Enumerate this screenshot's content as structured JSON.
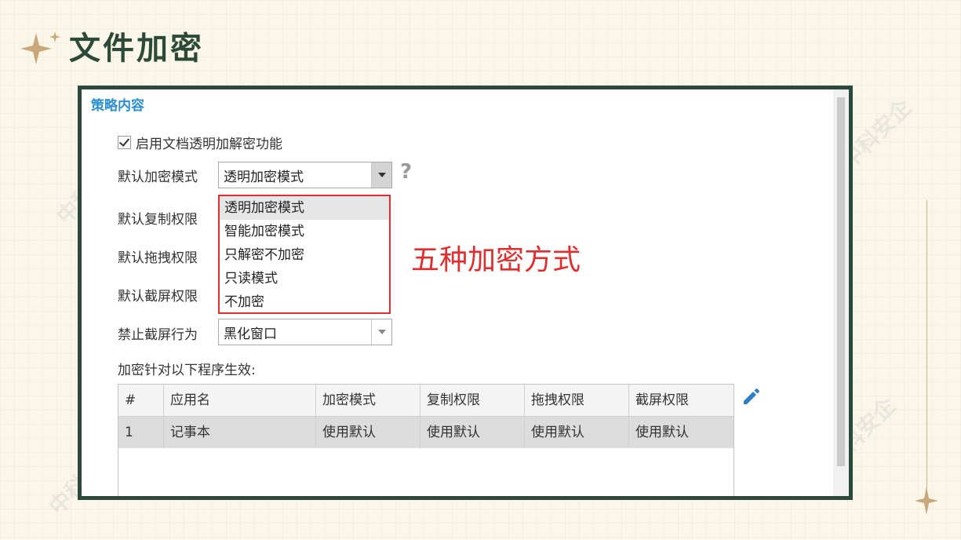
{
  "slide": {
    "title": "文件加密"
  },
  "watermark": {
    "text": "中科安企"
  },
  "panel": {
    "section_title": "策略内容",
    "enable_checkbox": {
      "label": "启用文档透明加解密功能",
      "checked": true
    },
    "fields": {
      "encrypt_mode": {
        "label": "默认加密模式",
        "value": "透明加密模式"
      },
      "copy_perm": {
        "label": "默认复制权限"
      },
      "drag_perm": {
        "label": "默认拖拽权限"
      },
      "screenshot_perm": {
        "label": "默认截屏权限"
      },
      "screenshot_block": {
        "label": "禁止截屏行为",
        "value": "黑化窗口"
      }
    },
    "help_icon": "?",
    "dropdown_options": [
      "透明加密模式",
      "智能加密模式",
      "只解密不加密",
      "只读模式",
      "不加密"
    ],
    "annotation": "五种加密方式",
    "table_caption": "加密针对以下程序生效:",
    "table": {
      "columns": [
        "#",
        "应用名",
        "加密模式",
        "复制权限",
        "拖拽权限",
        "截屏权限"
      ],
      "rows": [
        [
          "1",
          "记事本",
          "使用默认",
          "使用默认",
          "使用默认",
          "使用默认"
        ]
      ]
    }
  },
  "colors": {
    "title": "#2c4a3a",
    "frame": "#2b4a3b",
    "section_title": "#2a8fd0",
    "annotation": "#e32d2d",
    "pencil": "#2a7fc8"
  },
  "icons": [
    "sparkle-star-icon",
    "question-icon",
    "dropdown-arrow-icon",
    "checkmark-icon",
    "pencil-icon"
  ]
}
